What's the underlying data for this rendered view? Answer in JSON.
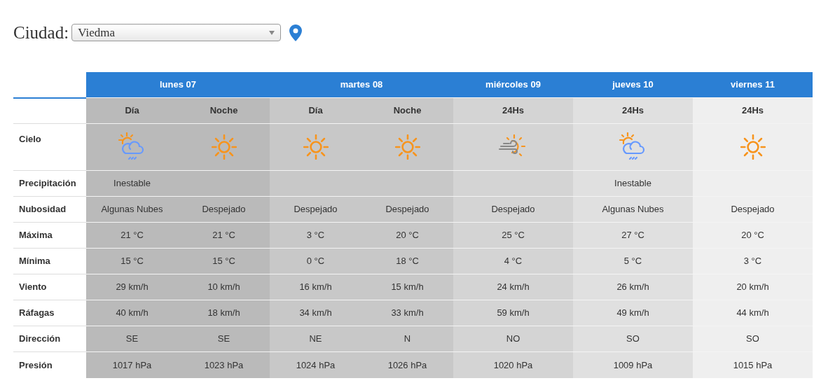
{
  "city": {
    "label": "Ciudad:",
    "value": "Viedma"
  },
  "row_labels": [
    "Cielo",
    "Precipitación",
    "Nubosidad",
    "Máxima",
    "Mínima",
    "Viento",
    "Ráfagas",
    "Dirección",
    "Presión"
  ],
  "days": [
    {
      "name": "lunes 07",
      "color": "#bababa",
      "periods": [
        {
          "label": "Día",
          "sky": {
            "kind": "sun-cloud-rain"
          },
          "precipitation": "Inestable",
          "clouds": "Algunas Nubes",
          "max": "21 °C",
          "min": "15 °C",
          "wind": "29 km/h",
          "gusts": "40 km/h",
          "direction": "SE",
          "pressure": "1017 hPa"
        },
        {
          "label": "Noche",
          "sky": {
            "kind": "sun"
          },
          "clouds": "Despejado",
          "max": "21 °C",
          "min": "15 °C",
          "wind": "10 km/h",
          "gusts": "18 km/h",
          "direction": "SE",
          "pressure": "1023 hPa"
        }
      ]
    },
    {
      "name": "martes 08",
      "color": "#c8c8c8",
      "periods": [
        {
          "label": "Día",
          "sky": {
            "kind": "sun"
          },
          "clouds": "Despejado",
          "max": "3 °C",
          "min": "0 °C",
          "wind": "16 km/h",
          "gusts": "34 km/h",
          "direction": "NE",
          "pressure": "1024 hPa"
        },
        {
          "label": "Noche",
          "sky": {
            "kind": "sun"
          },
          "clouds": "Despejado",
          "max": "20 °C",
          "min": "18 °C",
          "wind": "15 km/h",
          "gusts": "33 km/h",
          "direction": "N",
          "pressure": "1026 hPa"
        }
      ]
    },
    {
      "name": "miércoles 09",
      "color": "#d4d4d4",
      "periods": [
        {
          "label": "24Hs",
          "sky": {
            "kind": "sun-wind"
          },
          "clouds": "Despejado",
          "max": "25 °C",
          "min": "4 °C",
          "wind": "24 km/h",
          "gusts": "59 km/h",
          "direction": "NO",
          "pressure": "1020 hPa"
        }
      ]
    },
    {
      "name": "jueves 10",
      "color": "#e0e0e0",
      "periods": [
        {
          "label": "24Hs",
          "sky": {
            "kind": "sun-cloud-rain"
          },
          "precipitation": "Inestable",
          "clouds": "Algunas Nubes",
          "max": "27 °C",
          "min": "5 °C",
          "wind": "26 km/h",
          "gusts": "49 km/h",
          "direction": "SO",
          "pressure": "1009 hPa"
        }
      ]
    },
    {
      "name": "viernes 11",
      "color": "#efefef",
      "periods": [
        {
          "label": "24Hs",
          "sky": {
            "kind": "sun"
          },
          "clouds": "Despejado",
          "max": "20 °C",
          "min": "3 °C",
          "wind": "20 km/h",
          "gusts": "44 km/h",
          "direction": "SO",
          "pressure": "1015 hPa"
        }
      ]
    }
  ]
}
